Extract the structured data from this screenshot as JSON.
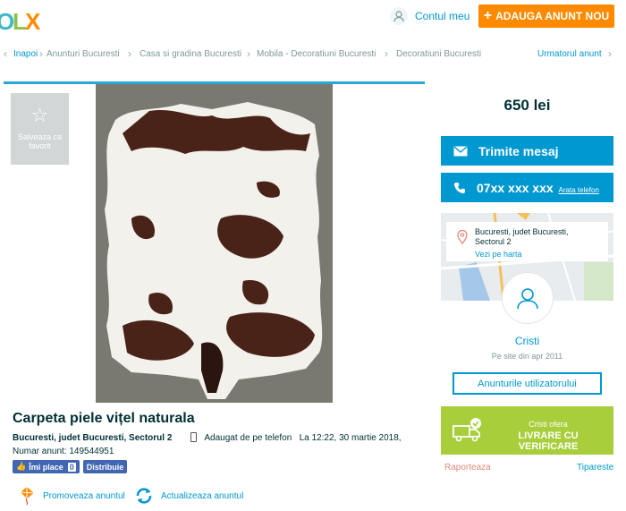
{
  "header": {
    "logo": "OLX",
    "account_label": "Contul meu",
    "add_button_label": "ADAUGA ANUNT NOU"
  },
  "breadcrumb": {
    "back_label": "Inapoi",
    "items": [
      "Anunturi Bucuresti",
      "Casa si gradina Bucuresti",
      "Mobila - Decoratiuni Bucuresti",
      "Decoratiuni Bucuresti"
    ],
    "next_label": "Urmatorul anunt"
  },
  "favorite": {
    "label": "Salveaza ca favorit"
  },
  "listing": {
    "title": "Carpeta piele vițel naturala",
    "location": "Bucuresti, judet Bucuresti, Sectorul 2",
    "added_via": "Adaugat de pe telefon",
    "added_at": "La 12:22, 30 martie 2018,",
    "ad_number": "Numar anunt: 149544951",
    "like_label": "Îmi place",
    "like_count": "0",
    "share_label": "Distribuie",
    "promote_label": "Promoveaza anuntul",
    "update_label": "Actualizeaza anuntul"
  },
  "sidebar": {
    "price": "650 lei",
    "message_button": "Trimite mesaj",
    "phone_masked": "07xx xxx xxx",
    "show_phone": "Arata telefon",
    "location_line1": "Bucuresti, judet Bucuresti,",
    "location_line2": "Sectorul 2",
    "map_link": "Vezi pe harta",
    "user_name": "Cristi",
    "member_since": "Pe site din apr 2011",
    "user_ads_button": "Anunturile utilizatorului",
    "delivery_line1": "Cristi ofera",
    "delivery_line2": "LIVRARE CU VERIFICARE",
    "report_label": "Raporteaza",
    "print_label": "Tipareste"
  },
  "colors": {
    "accent": "#0098d0",
    "orange": "#ff8a00",
    "green": "#a8ce3b",
    "logo_o": "#3fb9c8",
    "logo_l": "#8bc34a",
    "logo_x": "#ff8a00"
  }
}
